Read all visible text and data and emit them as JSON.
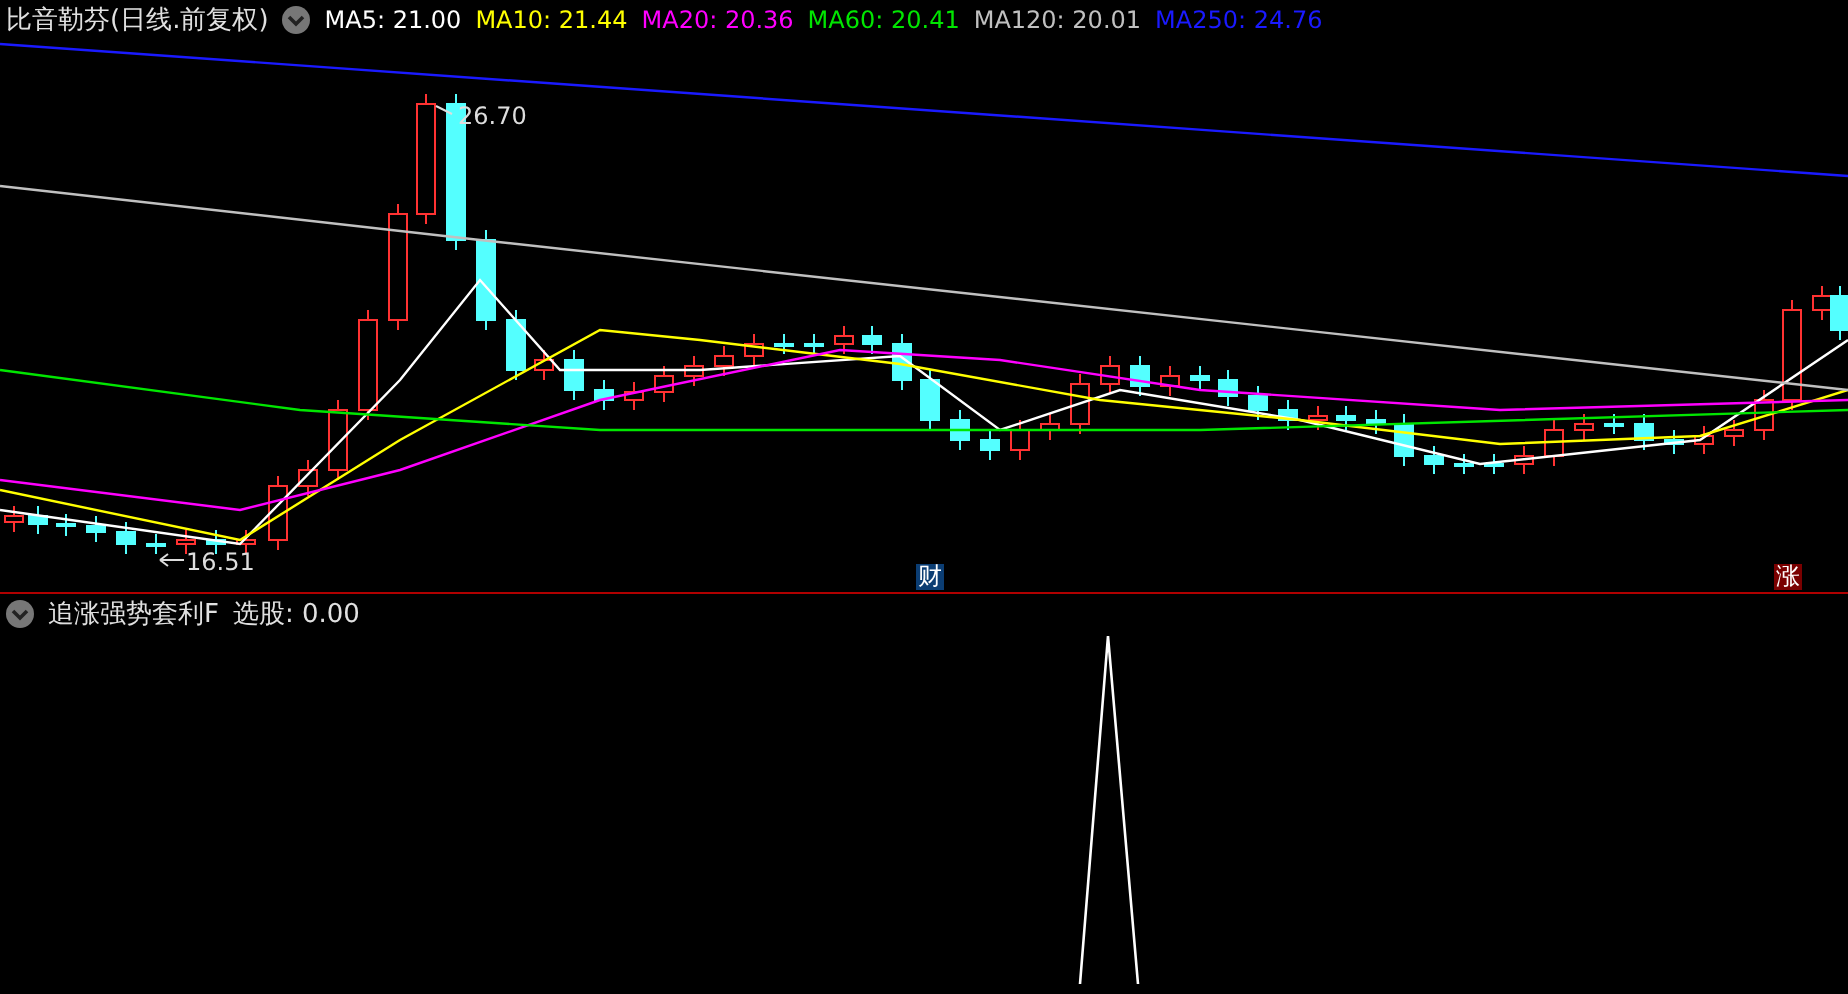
{
  "main_panel": {
    "title": "比音勒芬(日线.前复权)",
    "ma_legend": [
      {
        "label": "MA5: 21.00",
        "color": "#ffffff"
      },
      {
        "label": "MA10: 21.44",
        "color": "#ffff00"
      },
      {
        "label": "MA20: 20.36",
        "color": "#ff00ff"
      },
      {
        "label": "MA60: 20.41",
        "color": "#00e600"
      },
      {
        "label": "MA120: 20.01",
        "color": "#c0c0c0"
      },
      {
        "label": "MA250: 24.76",
        "color": "#1a1aff"
      }
    ],
    "high_label": "26.70",
    "low_label": "16.51",
    "event_markers": [
      {
        "label": "财",
        "color": "#0b3d73"
      },
      {
        "label": "涨",
        "color": "#7a0000"
      }
    ]
  },
  "indicator_panel": {
    "title": "追涨强势套利F",
    "value": "选股: 0.00"
  }
}
